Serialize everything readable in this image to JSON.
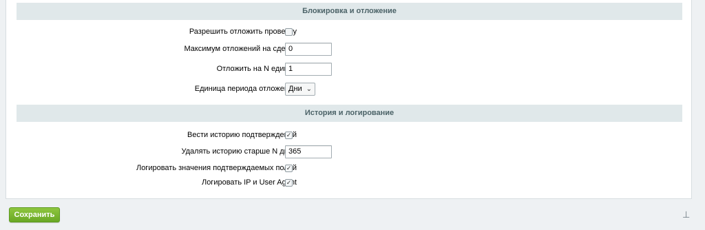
{
  "sections": [
    {
      "title": "Блокировка и отложение",
      "rows": [
        {
          "label": "Разрешить отложить проверку",
          "type": "checkbox",
          "checked": false
        },
        {
          "label": "Максимум отложений на сделку",
          "type": "text",
          "value": "0"
        },
        {
          "label": "Отложить на N единиц",
          "type": "text",
          "value": "1"
        },
        {
          "label": "Единица периода отложения",
          "type": "select",
          "value": "Дни"
        }
      ]
    },
    {
      "title": "История и логирование",
      "rows": [
        {
          "label": "Вести историю подтверждений",
          "type": "checkbox",
          "checked": true
        },
        {
          "label": "Удалять историю старше N дней",
          "type": "text",
          "value": "365"
        },
        {
          "label": "Логировать значения подтверждаемых полей",
          "type": "checkbox",
          "checked": true
        },
        {
          "label": "Логировать IP и User Agent",
          "type": "checkbox",
          "checked": true
        }
      ]
    }
  ],
  "footer": {
    "save_label": "Сохранить",
    "pin_icon": "pin-icon"
  },
  "colors": {
    "section_bg": "#e0e8ea",
    "save_button": "#7cb832"
  }
}
